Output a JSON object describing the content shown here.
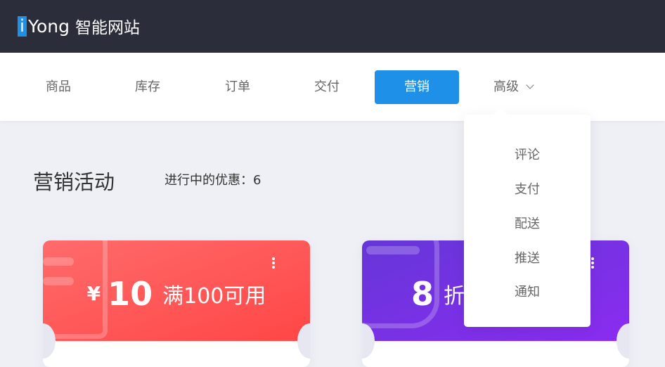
{
  "header": {
    "logo_i": "i",
    "logo_text": "Yong",
    "site_name": "智能网站"
  },
  "nav": {
    "tabs": [
      {
        "label": "商品"
      },
      {
        "label": "库存"
      },
      {
        "label": "订单"
      },
      {
        "label": "交付"
      },
      {
        "label": "营销",
        "active": true
      },
      {
        "label": "高级"
      }
    ]
  },
  "dropdown": {
    "items": [
      {
        "label": "评论"
      },
      {
        "label": "支付"
      },
      {
        "label": "配送"
      },
      {
        "label": "推送"
      },
      {
        "label": "通知"
      }
    ]
  },
  "main": {
    "title": "营销活动",
    "active_label": "进行中的优惠：",
    "active_count": "6",
    "cards": [
      {
        "currency": "¥",
        "value": "10",
        "desc": "满100可用",
        "color": "#ff4d4d"
      },
      {
        "value": "8",
        "desc": "折",
        "color": "#7a2fe6"
      }
    ]
  }
}
